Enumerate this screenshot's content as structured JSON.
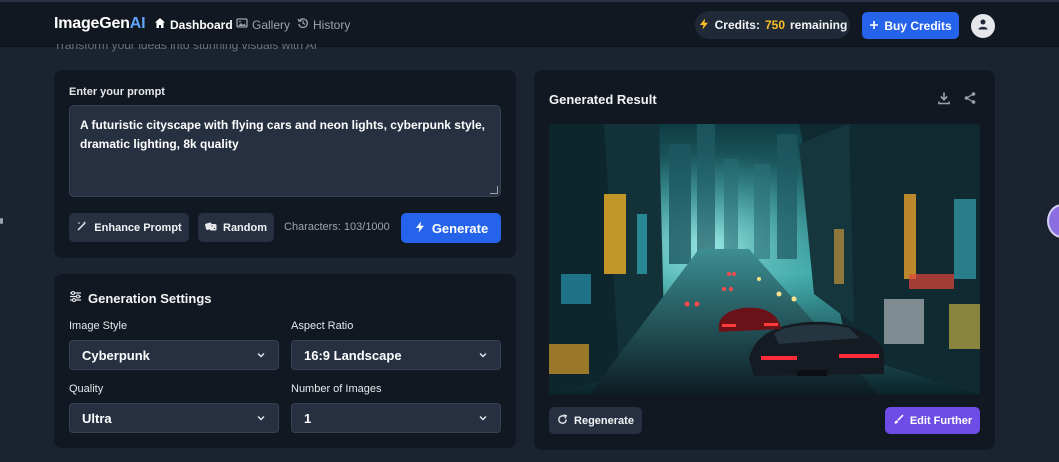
{
  "header": {
    "brand_main": "ImageGen",
    "brand_accent": "AI",
    "nav": [
      {
        "label": "Dashboard",
        "icon": "home-icon",
        "active": true
      },
      {
        "label": "Gallery",
        "icon": "image-icon",
        "active": false
      },
      {
        "label": "History",
        "icon": "history-icon",
        "active": false
      }
    ],
    "credits_label": "Credits:",
    "credits_value": "750",
    "credits_suffix": "remaining",
    "buy_label": "Buy Credits"
  },
  "subtitle": "Transform your ideas into stunning visuals with AI",
  "prompt": {
    "label": "Enter your prompt",
    "text": "A futuristic cityscape with flying cars and neon lights, cyberpunk style, dramatic lighting, 8k quality",
    "enhance_label": "Enhance Prompt",
    "random_label": "Random",
    "char_count": "Characters: 103/1000",
    "generate_label": "Generate"
  },
  "settings": {
    "title": "Generation Settings",
    "style_label": "Image Style",
    "style_value": "Cyberpunk",
    "aspect_label": "Aspect Ratio",
    "aspect_value": "16:9 Landscape",
    "quality_label": "Quality",
    "quality_value": "Ultra",
    "count_label": "Number of Images",
    "count_value": "1"
  },
  "result": {
    "title": "Generated Result",
    "regenerate_label": "Regenerate",
    "edit_label": "Edit Further"
  },
  "colors": {
    "accent_blue": "#2563eb",
    "accent_purple": "#6d4de6",
    "credits_gold": "#fbbf24"
  }
}
